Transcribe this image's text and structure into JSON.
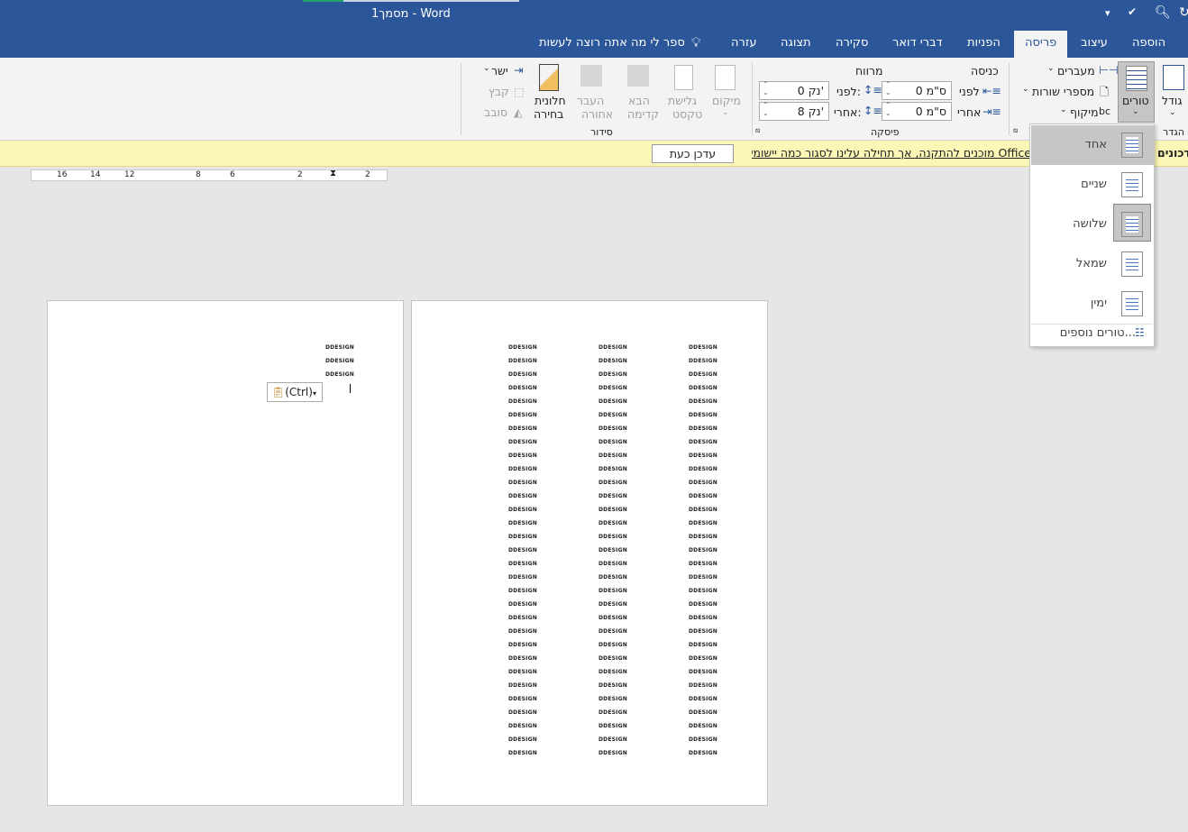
{
  "titlebar": {
    "title": "מסמך1 - Word"
  },
  "tabs": [
    {
      "label": "הוספה"
    },
    {
      "label": "עיצוב"
    },
    {
      "label": "פריסה",
      "active": true
    },
    {
      "label": "הפניות"
    },
    {
      "label": "דברי דואר"
    },
    {
      "label": "סקירה"
    },
    {
      "label": "תצוגה"
    },
    {
      "label": "עזרה"
    }
  ],
  "tellme": "ספר לי מה אתה רוצה לעשות",
  "ribbon": {
    "page_setup": {
      "size": "גודל",
      "columns": "טורים",
      "breaks": "מעברים",
      "line_numbers": "מספרי שורות",
      "hyphenation": "מיקוף",
      "group": "הגדר"
    },
    "paragraph": {
      "group": "פיסקה",
      "indent": "כניסה",
      "spacing": "מרווח",
      "indent_before_label": "לפני",
      "indent_after_label": "אחרי",
      "indent_before": "0 ס\"מ",
      "indent_after": "0 ס\"מ",
      "spacing_before_label": "לפני:",
      "spacing_after_label": "אחרי:",
      "spacing_before": "0 נק'",
      "spacing_after": "8 נק'"
    },
    "arrange": {
      "group": "סידור",
      "position": "מיקום",
      "wrap1": "גלישת",
      "wrap2": "טקסט",
      "forward1": "הבא",
      "forward2": "קדימה",
      "backward1": "העבר",
      "backward2": "אחורה",
      "pane1": "חלונית",
      "pane2": "בחירה",
      "align": "ישר",
      "group_btn": "קבץ",
      "rotate": "סובב"
    }
  },
  "message": {
    "bold": "עדכונים",
    "text": "Office מוכנים להתקנה, אך תחילה עלינו לסגור כמה יישומים.",
    "button": "עדכן כעת"
  },
  "ruler": {
    "ticks": [
      "16",
      "14",
      "12",
      "8",
      "6",
      "2",
      "2"
    ]
  },
  "columns_menu": {
    "items": [
      {
        "label": "אחד",
        "cols": 1
      },
      {
        "label": "שניים",
        "cols": 2
      },
      {
        "label": "שלושה",
        "cols": 3,
        "selected": true
      },
      {
        "label": "שמאל",
        "cols": 2
      },
      {
        "label": "ימין",
        "cols": 2
      }
    ],
    "more": "טורים נוספים..."
  },
  "document": {
    "word": "DDESIGN",
    "paste_label": "(Ctrl)",
    "page1_lines": 3,
    "page2_rows": 31,
    "page2_cols": 3
  }
}
